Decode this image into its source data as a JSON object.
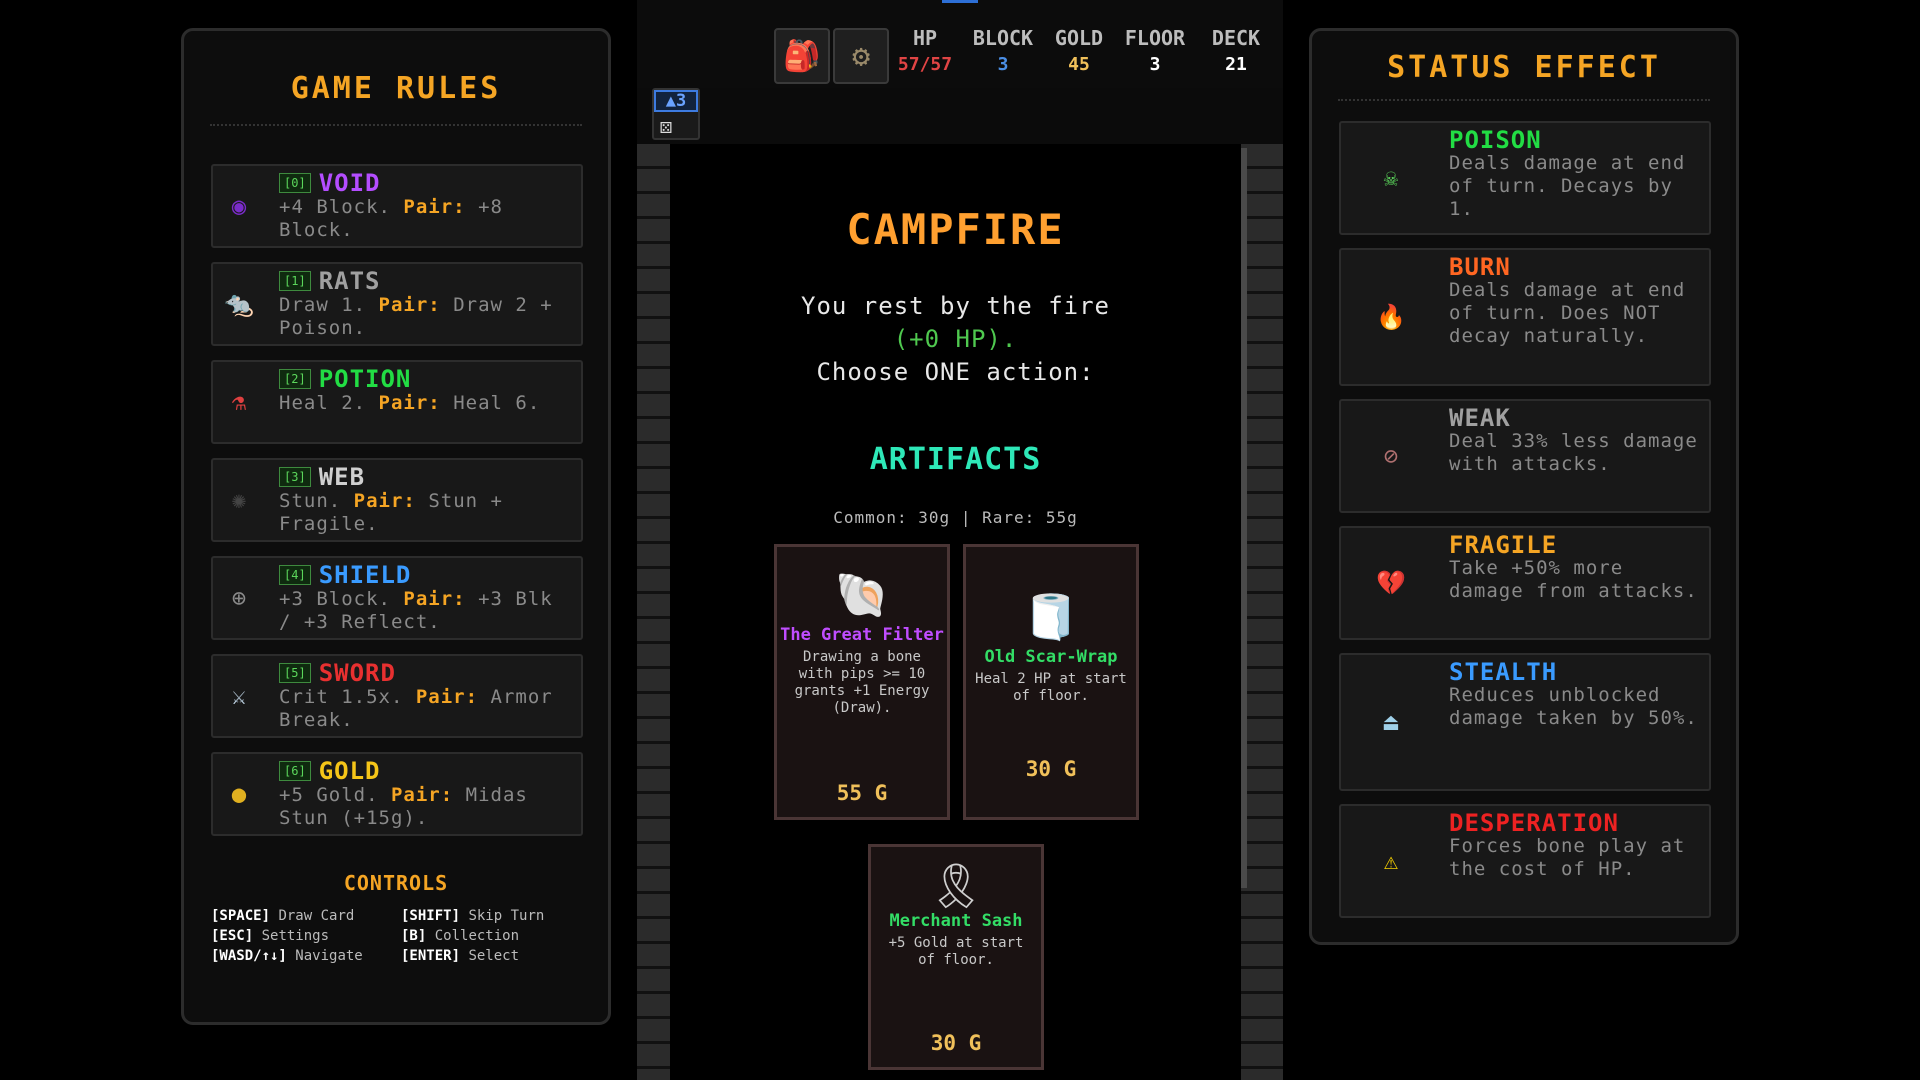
{
  "left_panel": {
    "title": "GAME RULES",
    "rules": [
      {
        "key": "[0]",
        "name": "VOID",
        "color": "#b44dff",
        "icon": "void-orb-icon",
        "glyph": "◉",
        "glyph_color": "#7a2cc9",
        "desc": "+4 Block.",
        "pair_label": "Pair:",
        "pair_desc": "+8 Block."
      },
      {
        "key": "[1]",
        "name": "RATS",
        "color": "#a0a0a0",
        "icon": "rat-icon",
        "glyph": "🐀",
        "glyph_color": "#8a6a50",
        "desc": "Draw 1.",
        "pair_label": "Pair:",
        "pair_desc": "Draw 2 + Poison."
      },
      {
        "key": "[2]",
        "name": "POTION",
        "color": "#22dd44",
        "icon": "potion-icon",
        "glyph": "⚗",
        "glyph_color": "#e04040",
        "desc": "Heal 2.",
        "pair_label": "Pair:",
        "pair_desc": "Heal 6."
      },
      {
        "key": "[3]",
        "name": "WEB",
        "color": "#d0d0d0",
        "icon": "spider-icon",
        "glyph": "✺",
        "glyph_color": "#444444",
        "desc": "Stun.",
        "pair_label": "Pair:",
        "pair_desc": "Stun + Fragile."
      },
      {
        "key": "[4]",
        "name": "SHIELD",
        "color": "#3a9bff",
        "icon": "shield-icon",
        "glyph": "⊕",
        "glyph_color": "#8a8a8a",
        "desc": "+3 Block.",
        "pair_label": "Pair:",
        "pair_desc": "+3 Blk / +3 Reflect."
      },
      {
        "key": "[5]",
        "name": "SWORD",
        "color": "#e83030",
        "icon": "sword-icon",
        "glyph": "⚔",
        "glyph_color": "#bcd0e0",
        "desc": "Crit 1.5x.",
        "pair_label": "Pair:",
        "pair_desc": "Armor Break."
      },
      {
        "key": "[6]",
        "name": "GOLD",
        "color": "#f5c518",
        "icon": "gold-coin-icon",
        "glyph": "●",
        "glyph_color": "#e0b020",
        "desc": "+5 Gold.",
        "pair_label": "Pair:",
        "pair_desc": "Midas Stun (+15g)."
      }
    ],
    "controls_title": "CONTROLS",
    "controls": [
      {
        "key": "[SPACE]",
        "label": "Draw Card"
      },
      {
        "key": "[SHIFT]",
        "label": "Skip Turn"
      },
      {
        "key": "[ESC]",
        "label": "Settings"
      },
      {
        "key": "[B]",
        "label": "Collection"
      },
      {
        "key": "[WASD/↑↓]",
        "label": "Navigate"
      },
      {
        "key": "[ENTER]",
        "label": "Select"
      }
    ]
  },
  "topbar": {
    "stats": [
      {
        "label": "HP",
        "value": "57/57",
        "color": "#e04444"
      },
      {
        "label": "BLOCK",
        "value": "3",
        "color": "#4b8fe6"
      },
      {
        "label": "GOLD",
        "value": "45",
        "color": "#f0c05a"
      },
      {
        "label": "FLOOR",
        "value": "3",
        "color": "#ffffff"
      },
      {
        "label": "DECK",
        "value": "21",
        "color": "#ffffff"
      }
    ],
    "ascension": "3",
    "ascension_icon": "ascension-icon",
    "backpack_icon": "backpack-icon",
    "settings_icon": "gear-icon"
  },
  "campfire": {
    "title": "CAMPFIRE",
    "line1": "You rest by the fire",
    "hp_gain": "(+0 HP).",
    "line3": "Choose ONE action:",
    "artifacts_title": "ARTIFACTS",
    "prices": "Common: 30g | Rare: 55g",
    "cards": [
      {
        "name": "The Great Filter",
        "rarity_color": "#c04dff",
        "icon": "filter-shell-icon",
        "glyph": "🐚",
        "desc": "Drawing a bone with pips >= 10 grants +1 Energy (Draw).",
        "price": "55 G"
      },
      {
        "name": "Old Scar-Wrap",
        "rarity_color": "#33dd66",
        "icon": "bandage-roll-icon",
        "glyph": "🧻",
        "desc": "Heal 2 HP at start of floor.",
        "price": "30 G"
      },
      {
        "name": "Merchant Sash",
        "rarity_color": "#33dd66",
        "icon": "sash-icon",
        "glyph": "🎗",
        "desc": "+5 Gold at start of floor.",
        "price": "30 G"
      }
    ]
  },
  "right_panel": {
    "title": "STATUS EFFECT",
    "effects": [
      {
        "name": "POISON",
        "color": "#22dd44",
        "icon": "skull-icon",
        "glyph": "☠",
        "glyph_color": "#5bd65b",
        "desc": "Deals damage at end of turn. Decays by 1."
      },
      {
        "name": "BURN",
        "color": "#ff6622",
        "icon": "flame-icon",
        "glyph": "🔥",
        "glyph_color": "#ff7a30",
        "desc": "Deals damage at end of turn. Does NOT decay naturally."
      },
      {
        "name": "WEAK",
        "color": "#a0a0a0",
        "icon": "broken-shield-icon",
        "glyph": "⊘",
        "glyph_color": "#b07070",
        "desc": "Deal 33% less damage with attacks."
      },
      {
        "name": "FRAGILE",
        "color": "#f5a524",
        "icon": "broken-heart-icon",
        "glyph": "💔",
        "glyph_color": "#d03040",
        "desc": "Take +50% more damage from attacks."
      },
      {
        "name": "STEALTH",
        "color": "#3a9bff",
        "icon": "cloak-icon",
        "glyph": "⏏",
        "glyph_color": "#9fd0e8",
        "desc": "Reduces unblocked damage taken by 50%."
      },
      {
        "name": "DESPERATION",
        "color": "#ee2222",
        "icon": "warning-icon",
        "glyph": "⚠",
        "glyph_color": "#f5d000",
        "desc": "Forces bone play at the cost of HP."
      }
    ]
  }
}
